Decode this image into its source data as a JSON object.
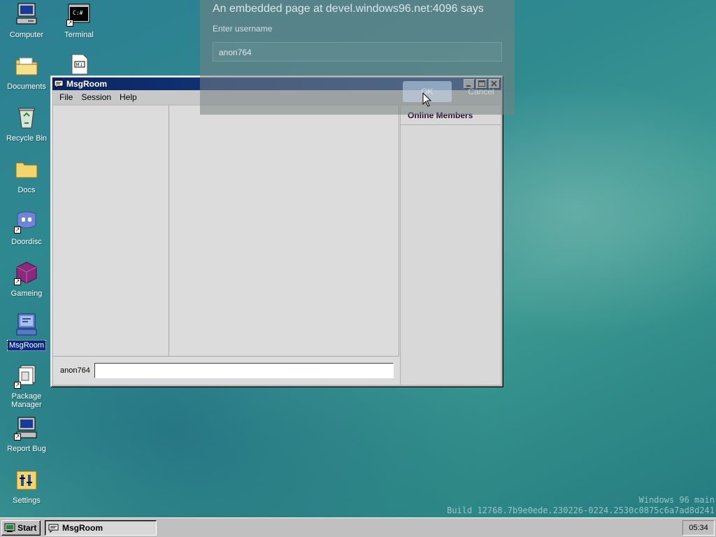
{
  "desktop": {
    "icons": [
      {
        "label": "Computer"
      },
      {
        "label": "Terminal"
      },
      {
        "label": "Documents"
      },
      {
        "label": "Recycle Bin"
      },
      {
        "label": "Docs"
      },
      {
        "label": "Doordisc"
      },
      {
        "label": "Gameing"
      },
      {
        "label": "MsgRoom"
      },
      {
        "label": "Package Manager"
      },
      {
        "label": "Report Bug"
      },
      {
        "label": "Settings"
      }
    ],
    "selected_icon": "MsgRoom",
    "watermark": {
      "line1": "Windows 96 main",
      "line2": "Build 12768.7b9e0ede.230226-0224.2530c0875c6a7ad8d241"
    }
  },
  "prompt_dialog": {
    "message": "An embedded page at devel.windows96.net:4096 says",
    "prompt": "Enter username",
    "input_value": "anon764",
    "ok_label": "OK",
    "cancel_label": "Cancel"
  },
  "window": {
    "title": "MsgRoom",
    "menu": [
      "File",
      "Session",
      "Help"
    ],
    "members_header": "Online Members",
    "username": "anon764",
    "message_placeholder": "",
    "controls": {
      "minimize": "_",
      "maximize": "□",
      "close": "×"
    }
  },
  "taskbar": {
    "start_label": "Start",
    "task_label": "MsgRoom",
    "clock": "05:34"
  },
  "colors": {
    "titlebar": "#0a2463",
    "desktop": "#2f8a8f",
    "selection": "#0a2a8a"
  }
}
